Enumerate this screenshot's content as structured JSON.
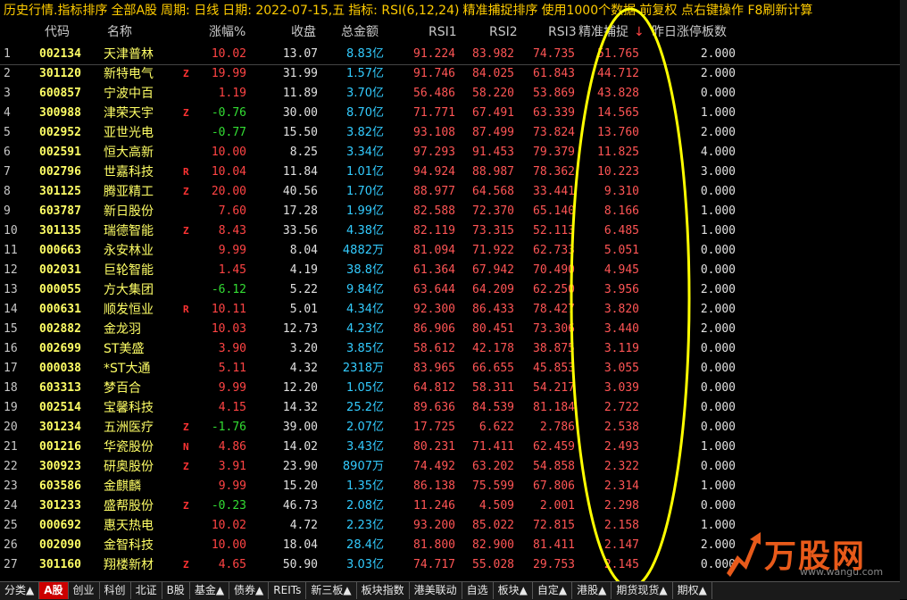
{
  "title": {
    "main": "历史行情.指标排序",
    "scope": "全部A股",
    "period": "周期: 日线",
    "date": "日期: 2022-07-15,五",
    "indicator": "指标: RSI(6,12,24)",
    "sort_name": "精准捕捉排序",
    "note": "使用1000个数据 前复权 点右键操作 F8刷新计算"
  },
  "columns": {
    "code": "代码",
    "name": "名称",
    "chg": "涨幅%",
    "close": "收盘",
    "amount": "总金额",
    "rsi1": "RSI1",
    "rsi2": "RSI2",
    "rsi3": "RSI3",
    "capture": "精准捕捉",
    "sort_arrow": "↓",
    "prev_limit": "昨日涨停板数"
  },
  "rows": [
    {
      "idx": "1",
      "code": "002134",
      "name": "天津普林",
      "flag": "",
      "chg": "10.02",
      "close": "13.07",
      "amount": "8.83亿",
      "rsi1": "91.224",
      "rsi2": "83.982",
      "rsi3": "74.735",
      "capture": "51.765",
      "prev": "2.000"
    },
    {
      "idx": "2",
      "code": "301120",
      "name": "新特电气",
      "flag": "Z",
      "chg": "19.99",
      "close": "31.99",
      "amount": "1.57亿",
      "rsi1": "91.746",
      "rsi2": "84.025",
      "rsi3": "61.843",
      "capture": "44.712",
      "prev": "2.000"
    },
    {
      "idx": "3",
      "code": "600857",
      "name": "宁波中百",
      "flag": "",
      "chg": "1.19",
      "close": "11.89",
      "amount": "3.70亿",
      "rsi1": "56.486",
      "rsi2": "58.220",
      "rsi3": "53.869",
      "capture": "43.828",
      "prev": "0.000"
    },
    {
      "idx": "4",
      "code": "300988",
      "name": "津荣天宇",
      "flag": "Z",
      "chg": "-0.76",
      "close": "30.00",
      "amount": "8.70亿",
      "rsi1": "71.771",
      "rsi2": "67.491",
      "rsi3": "63.339",
      "capture": "14.565",
      "prev": "1.000"
    },
    {
      "idx": "5",
      "code": "002952",
      "name": "亚世光电",
      "flag": "",
      "chg": "-0.77",
      "close": "15.50",
      "amount": "3.82亿",
      "rsi1": "93.108",
      "rsi2": "87.499",
      "rsi3": "73.824",
      "capture": "13.760",
      "prev": "2.000"
    },
    {
      "idx": "6",
      "code": "002591",
      "name": "恒大高新",
      "flag": "",
      "chg": "10.00",
      "close": "8.25",
      "amount": "3.34亿",
      "rsi1": "97.293",
      "rsi2": "91.453",
      "rsi3": "79.379",
      "capture": "11.825",
      "prev": "4.000"
    },
    {
      "idx": "7",
      "code": "002796",
      "name": "世嘉科技",
      "flag": "R",
      "chg": "10.04",
      "close": "11.84",
      "amount": "1.01亿",
      "rsi1": "94.924",
      "rsi2": "88.987",
      "rsi3": "78.362",
      "capture": "10.223",
      "prev": "3.000"
    },
    {
      "idx": "8",
      "code": "301125",
      "name": "腾亚精工",
      "flag": "Z",
      "chg": "20.00",
      "close": "40.56",
      "amount": "1.70亿",
      "rsi1": "88.977",
      "rsi2": "64.568",
      "rsi3": "33.441",
      "capture": "9.310",
      "prev": "0.000"
    },
    {
      "idx": "9",
      "code": "603787",
      "name": "新日股份",
      "flag": "",
      "chg": "7.60",
      "close": "17.28",
      "amount": "1.99亿",
      "rsi1": "82.588",
      "rsi2": "72.370",
      "rsi3": "65.140",
      "capture": "8.166",
      "prev": "1.000"
    },
    {
      "idx": "10",
      "code": "301135",
      "name": "瑞德智能",
      "flag": "Z",
      "chg": "8.43",
      "close": "33.56",
      "amount": "4.38亿",
      "rsi1": "82.119",
      "rsi2": "73.315",
      "rsi3": "52.113",
      "capture": "6.485",
      "prev": "1.000"
    },
    {
      "idx": "11",
      "code": "000663",
      "name": "永安林业",
      "flag": "",
      "chg": "9.99",
      "close": "8.04",
      "amount": "4882万",
      "rsi1": "81.094",
      "rsi2": "71.922",
      "rsi3": "62.733",
      "capture": "5.051",
      "prev": "0.000"
    },
    {
      "idx": "12",
      "code": "002031",
      "name": "巨轮智能",
      "flag": "",
      "chg": "1.45",
      "close": "4.19",
      "amount": "38.8亿",
      "rsi1": "61.364",
      "rsi2": "67.942",
      "rsi3": "70.490",
      "capture": "4.945",
      "prev": "0.000"
    },
    {
      "idx": "13",
      "code": "000055",
      "name": "方大集团",
      "flag": "",
      "chg": "-6.12",
      "close": "5.22",
      "amount": "9.84亿",
      "rsi1": "63.644",
      "rsi2": "64.209",
      "rsi3": "62.250",
      "capture": "3.956",
      "prev": "2.000"
    },
    {
      "idx": "14",
      "code": "000631",
      "name": "顺发恒业",
      "flag": "R",
      "chg": "10.11",
      "close": "5.01",
      "amount": "4.34亿",
      "rsi1": "92.300",
      "rsi2": "86.433",
      "rsi3": "78.427",
      "capture": "3.820",
      "prev": "2.000"
    },
    {
      "idx": "15",
      "code": "002882",
      "name": "金龙羽",
      "flag": "",
      "chg": "10.03",
      "close": "12.73",
      "amount": "4.23亿",
      "rsi1": "86.906",
      "rsi2": "80.451",
      "rsi3": "73.306",
      "capture": "3.440",
      "prev": "2.000"
    },
    {
      "idx": "16",
      "code": "002699",
      "name": "ST美盛",
      "flag": "",
      "chg": "3.90",
      "close": "3.20",
      "amount": "3.85亿",
      "rsi1": "58.612",
      "rsi2": "42.178",
      "rsi3": "38.875",
      "capture": "3.119",
      "prev": "0.000"
    },
    {
      "idx": "17",
      "code": "000038",
      "name": "*ST大通",
      "flag": "",
      "chg": "5.11",
      "close": "4.32",
      "amount": "2318万",
      "rsi1": "83.965",
      "rsi2": "66.655",
      "rsi3": "45.853",
      "capture": "3.055",
      "prev": "0.000"
    },
    {
      "idx": "18",
      "code": "603313",
      "name": "梦百合",
      "flag": "",
      "chg": "9.99",
      "close": "12.20",
      "amount": "1.05亿",
      "rsi1": "64.812",
      "rsi2": "58.311",
      "rsi3": "54.217",
      "capture": "3.039",
      "prev": "0.000"
    },
    {
      "idx": "19",
      "code": "002514",
      "name": "宝馨科技",
      "flag": "",
      "chg": "4.15",
      "close": "14.32",
      "amount": "25.2亿",
      "rsi1": "89.636",
      "rsi2": "84.539",
      "rsi3": "81.184",
      "capture": "2.722",
      "prev": "0.000"
    },
    {
      "idx": "20",
      "code": "301234",
      "name": "五洲医疗",
      "flag": "Z",
      "chg": "-1.76",
      "close": "39.00",
      "amount": "2.07亿",
      "rsi1": "17.725",
      "rsi2": "6.622",
      "rsi3": "2.786",
      "capture": "2.538",
      "prev": "0.000"
    },
    {
      "idx": "21",
      "code": "001216",
      "name": "华瓷股份",
      "flag": "N",
      "chg": "4.86",
      "close": "14.02",
      "amount": "3.43亿",
      "rsi1": "80.231",
      "rsi2": "71.411",
      "rsi3": "62.459",
      "capture": "2.493",
      "prev": "1.000"
    },
    {
      "idx": "22",
      "code": "300923",
      "name": "研奥股份",
      "flag": "Z",
      "chg": "3.91",
      "close": "23.90",
      "amount": "8907万",
      "rsi1": "74.492",
      "rsi2": "63.202",
      "rsi3": "54.858",
      "capture": "2.322",
      "prev": "0.000"
    },
    {
      "idx": "23",
      "code": "603586",
      "name": "金麒麟",
      "flag": "",
      "chg": "9.99",
      "close": "15.20",
      "amount": "1.35亿",
      "rsi1": "86.138",
      "rsi2": "75.599",
      "rsi3": "67.806",
      "capture": "2.314",
      "prev": "1.000"
    },
    {
      "idx": "24",
      "code": "301233",
      "name": "盛帮股份",
      "flag": "Z",
      "chg": "-0.23",
      "close": "46.73",
      "amount": "2.08亿",
      "rsi1": "11.246",
      "rsi2": "4.509",
      "rsi3": "2.001",
      "capture": "2.298",
      "prev": "0.000"
    },
    {
      "idx": "25",
      "code": "000692",
      "name": "惠天热电",
      "flag": "",
      "chg": "10.02",
      "close": "4.72",
      "amount": "2.23亿",
      "rsi1": "93.200",
      "rsi2": "85.022",
      "rsi3": "72.815",
      "capture": "2.158",
      "prev": "1.000"
    },
    {
      "idx": "26",
      "code": "002090",
      "name": "金智科技",
      "flag": "",
      "chg": "10.00",
      "close": "18.04",
      "amount": "28.4亿",
      "rsi1": "81.800",
      "rsi2": "82.900",
      "rsi3": "81.411",
      "capture": "2.147",
      "prev": "2.000"
    },
    {
      "idx": "27",
      "code": "301160",
      "name": "翔楼新材",
      "flag": "Z",
      "chg": "4.65",
      "close": "50.90",
      "amount": "3.03亿",
      "rsi1": "74.717",
      "rsi2": "55.028",
      "rsi3": "29.753",
      "capture": "2.145",
      "prev": "0.000"
    }
  ],
  "tabs": [
    "分类▲",
    "A股",
    "创业",
    "科创",
    "北证",
    "B股",
    "基金▲",
    "债券▲",
    "REITs",
    "新三板▲",
    "板块指数",
    "港美联动",
    "自选",
    "板块▲",
    "自定▲",
    "港股▲",
    "期货现货▲",
    "期权▲"
  ],
  "active_tab": 1,
  "watermark": {
    "text": "万股网",
    "url": "www.wangu.com"
  },
  "colors": {
    "up": "#ff4444",
    "down": "#33dd33",
    "code": "#ffff66",
    "amount": "#33ccff",
    "highlight_ellipse": "#ffff00"
  }
}
